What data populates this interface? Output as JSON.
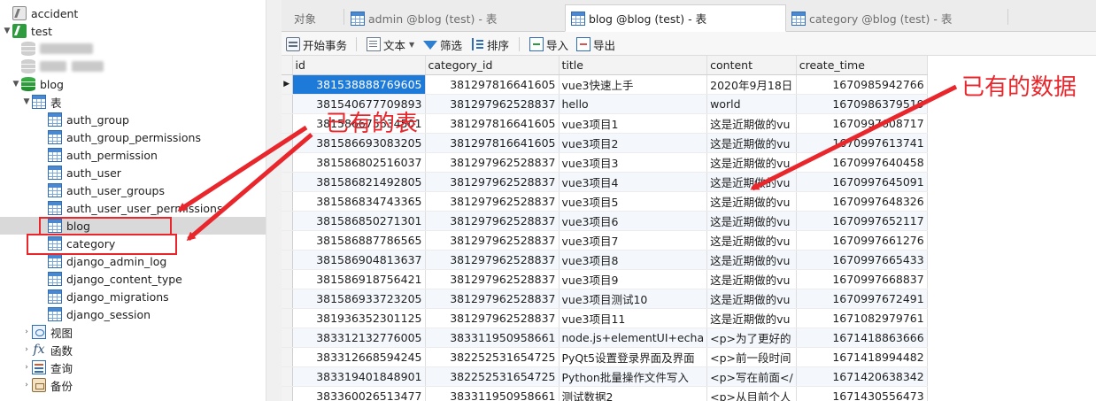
{
  "tree": {
    "nodes": [
      {
        "key": "accident",
        "label": "accident",
        "icon": "connection-icon",
        "level": 0,
        "expand": ""
      },
      {
        "key": "test",
        "label": "test",
        "icon": "connection-green-icon",
        "level": 0,
        "expand": "▼"
      },
      {
        "key": "blurred1",
        "label": "",
        "icon": "database-icon",
        "level": 1,
        "expand": "",
        "blurred": true
      },
      {
        "key": "blurred2",
        "label": "",
        "icon": "database-icon",
        "level": 1,
        "expand": "",
        "blurred": true
      },
      {
        "key": "blog-db",
        "label": "blog",
        "icon": "database-green-icon",
        "level": 1,
        "expand": "▼"
      },
      {
        "key": "tables",
        "label": "表",
        "icon": "table-folder-icon",
        "level": 2,
        "expand": "▼"
      },
      {
        "key": "auth_group",
        "label": "auth_group",
        "icon": "table-icon",
        "level": 3,
        "expand": ""
      },
      {
        "key": "auth_group_permissions",
        "label": "auth_group_permissions",
        "icon": "table-icon",
        "level": 3,
        "expand": ""
      },
      {
        "key": "auth_permission",
        "label": "auth_permission",
        "icon": "table-icon",
        "level": 3,
        "expand": ""
      },
      {
        "key": "auth_user",
        "label": "auth_user",
        "icon": "table-icon",
        "level": 3,
        "expand": ""
      },
      {
        "key": "auth_user_groups",
        "label": "auth_user_groups",
        "icon": "table-icon",
        "level": 3,
        "expand": ""
      },
      {
        "key": "auth_user_user_permissions",
        "label": "auth_user_user_permissions",
        "icon": "table-icon",
        "level": 3,
        "expand": ""
      },
      {
        "key": "blog",
        "label": "blog",
        "icon": "table-icon",
        "level": 3,
        "expand": "",
        "selected": true
      },
      {
        "key": "category",
        "label": "category",
        "icon": "table-icon",
        "level": 3,
        "expand": ""
      },
      {
        "key": "django_admin_log",
        "label": "django_admin_log",
        "icon": "table-icon",
        "level": 3,
        "expand": ""
      },
      {
        "key": "django_content_type",
        "label": "django_content_type",
        "icon": "table-icon",
        "level": 3,
        "expand": ""
      },
      {
        "key": "django_migrations",
        "label": "django_migrations",
        "icon": "table-icon",
        "level": 3,
        "expand": ""
      },
      {
        "key": "django_session",
        "label": "django_session",
        "icon": "table-icon",
        "level": 3,
        "expand": ""
      },
      {
        "key": "views",
        "label": "视图",
        "icon": "view-icon",
        "level": 2,
        "expand": "›"
      },
      {
        "key": "functions",
        "label": "函数",
        "icon": "function-icon",
        "level": 2,
        "expand": "›"
      },
      {
        "key": "queries",
        "label": "查询",
        "icon": "query-icon",
        "level": 2,
        "expand": "›"
      },
      {
        "key": "backups",
        "label": "备份",
        "icon": "backup-icon",
        "level": 2,
        "expand": "›"
      }
    ]
  },
  "tabs": [
    {
      "label": "对象",
      "active": false,
      "icon": ""
    },
    {
      "label": "admin @blog (test) - 表",
      "active": false,
      "icon": "table-icon"
    },
    {
      "label": "blog @blog (test) - 表",
      "active": true,
      "icon": "table-icon"
    },
    {
      "label": "category @blog (test) - 表",
      "active": false,
      "icon": "table-icon"
    }
  ],
  "toolbar": {
    "begin_transaction": "开始事务",
    "text": "文本",
    "filter": "筛选",
    "sort": "排序",
    "import": "导入",
    "export": "导出"
  },
  "grid": {
    "columns": [
      "id",
      "category_id",
      "title",
      "content",
      "create_time"
    ],
    "rows": [
      [
        "381538888769605",
        "381297816641605",
        "vue3快速上手",
        "2020年9月18日",
        "1670985942766"
      ],
      [
        "381540677709893",
        "381297962528837",
        "hello",
        "world",
        "1670986379519"
      ],
      [
        "381586675634501",
        "381297816641605",
        "vue3项目1",
        "这是近期做的vu",
        "1670997608717"
      ],
      [
        "381586693083205",
        "381297816641605",
        "vue3项目2",
        "这是近期做的vu",
        "1670997613741"
      ],
      [
        "381586802516037",
        "381297962528837",
        "vue3项目3",
        "这是近期做的vu",
        "1670997640458"
      ],
      [
        "381586821492805",
        "381297962528837",
        "vue3项目4",
        "这是近期做的vu",
        "1670997645091"
      ],
      [
        "381586834743365",
        "381297962528837",
        "vue3项目5",
        "这是近期做的vu",
        "1670997648326"
      ],
      [
        "381586850271301",
        "381297962528837",
        "vue3项目6",
        "这是近期做的vu",
        "1670997652117"
      ],
      [
        "381586887786565",
        "381297962528837",
        "vue3项目7",
        "这是近期做的vu",
        "1670997661276"
      ],
      [
        "381586904813637",
        "381297962528837",
        "vue3项目8",
        "这是近期做的vu",
        "1670997665433"
      ],
      [
        "381586918756421",
        "381297962528837",
        "vue3项目9",
        "这是近期做的vu",
        "1670997668837"
      ],
      [
        "381586933723205",
        "381297962528837",
        "vue3项目测试10",
        "这是近期做的vu",
        "1670997672491"
      ],
      [
        "381936352301125",
        "381297962528837",
        "vue3项目11",
        "这是近期做的vu",
        "1671082979761"
      ],
      [
        "383312132776005",
        "383311950958661",
        "node.js+elementUI+echa",
        "<p>为了更好的",
        "1671418863666"
      ],
      [
        "383312668594245",
        "382252531654725",
        "PyQt5设置登录界面及界面",
        "<p>前一段时间",
        "1671418994482"
      ],
      [
        "383319401848901",
        "382252531654725",
        "Python批量操作文件写入",
        "<p>写在前面</",
        "1671420638342"
      ],
      [
        "383360026513477",
        "383311950958661",
        "测试数据2",
        "<p>从目前个人",
        "1671430556473"
      ]
    ],
    "current_row_marker": "▶"
  },
  "annotations": {
    "tables_note": "已有的表",
    "data_note": "已有的数据",
    "color": "#e8262b"
  }
}
